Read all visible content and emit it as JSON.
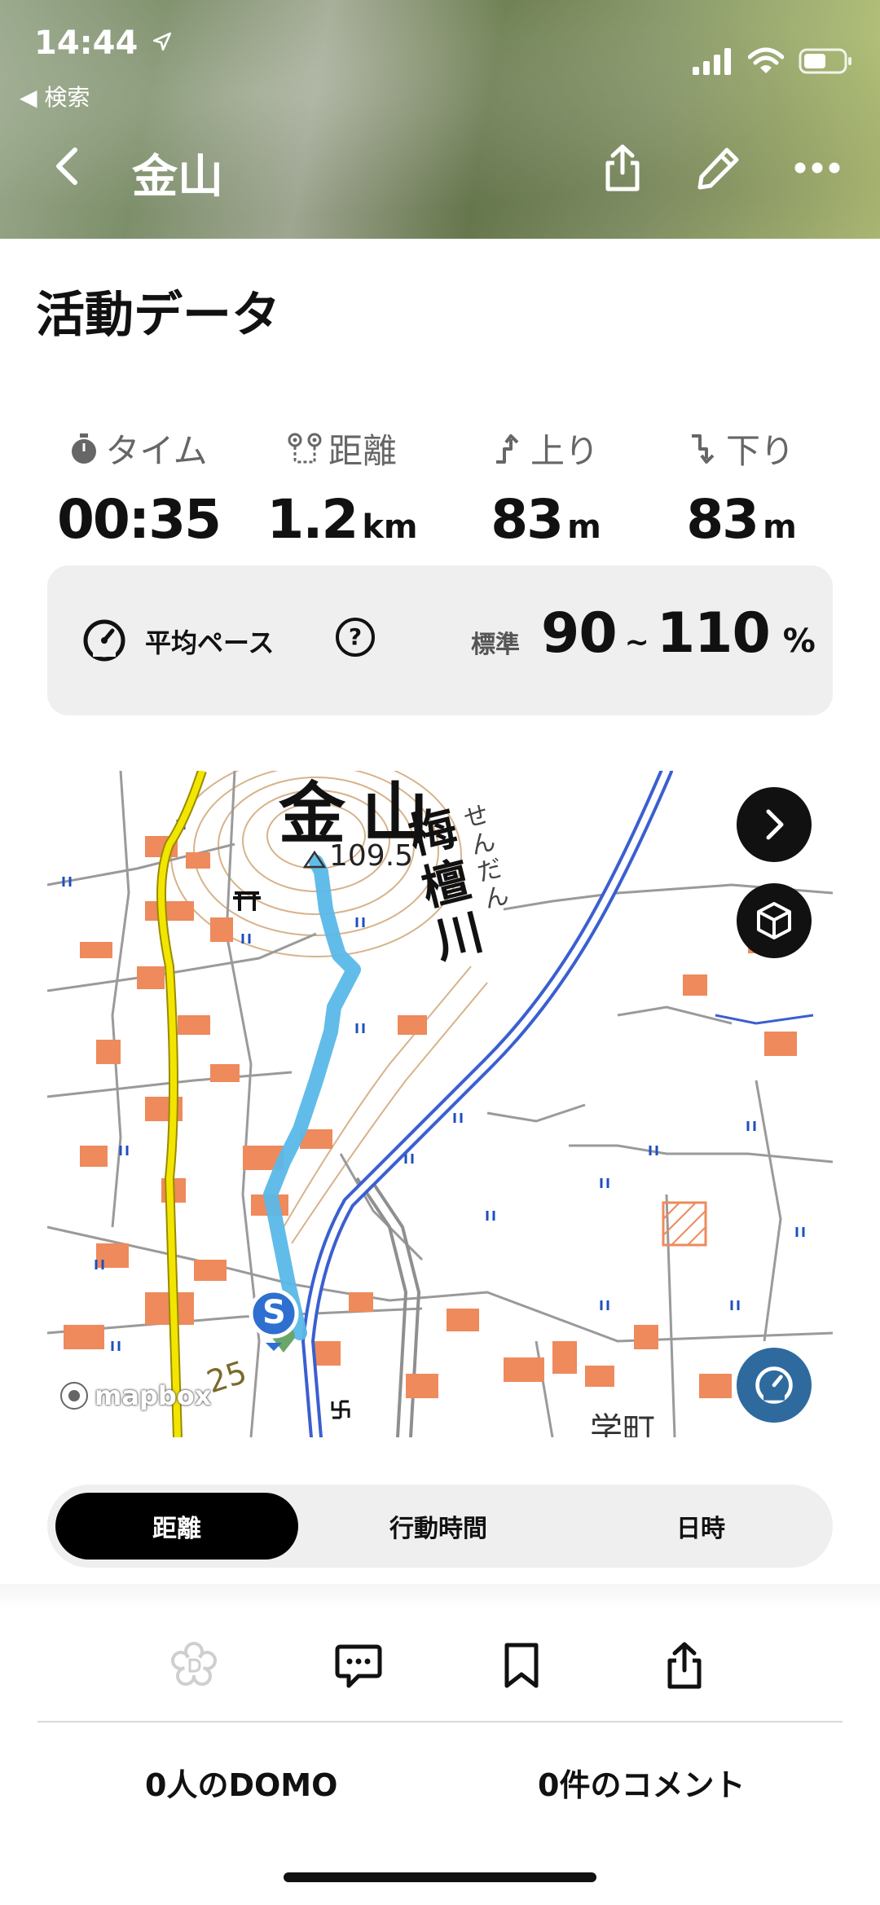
{
  "status_bar": {
    "time": "14:44",
    "back_app": "◀ 検索"
  },
  "nav": {
    "title": "金山"
  },
  "section": {
    "title": "活動データ"
  },
  "stats": [
    {
      "icon": "stopwatch-icon",
      "label": "タイム",
      "value": "00:35",
      "unit": ""
    },
    {
      "icon": "route-distance-icon",
      "label": "距離",
      "value": "1.2",
      "unit": "km"
    },
    {
      "icon": "ascent-icon",
      "label": "上り",
      "value": "83",
      "unit": "m"
    },
    {
      "icon": "descent-icon",
      "label": "下り",
      "value": "83",
      "unit": "m"
    }
  ],
  "pace": {
    "label": "平均ペース",
    "help": "?",
    "standard_label": "標準",
    "min": "90",
    "tilde": "~",
    "max": "110",
    "unit": "%"
  },
  "map": {
    "peak_name": "金山",
    "peak_elevation": "109.5",
    "river_name": "梅檀川",
    "river_reading": "せんだん",
    "road_number": "25",
    "district": "学町",
    "start_marker": "S",
    "attribution": "mapbox",
    "route_color": "#5ab8e8",
    "road_color": "#f2e600"
  },
  "tabs": [
    {
      "label": "距離",
      "active": true
    },
    {
      "label": "行動時間",
      "active": false
    },
    {
      "label": "日時",
      "active": false
    }
  ],
  "social": {
    "domo_count": "0人のDOMO",
    "comment_count": "0件のコメント"
  }
}
